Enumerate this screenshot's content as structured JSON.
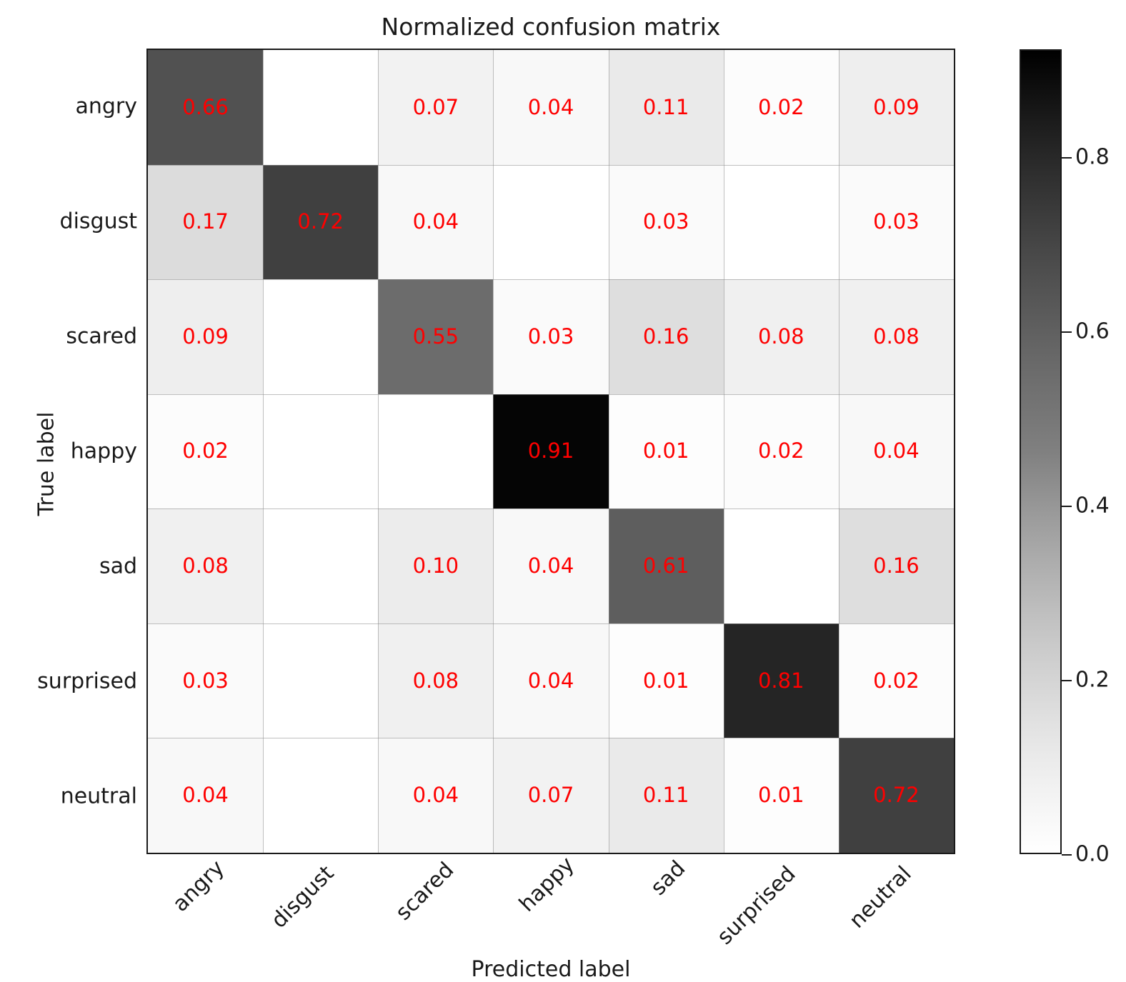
{
  "chart_data": {
    "type": "heatmap",
    "title": "Normalized confusion matrix",
    "xlabel": "Predicted label",
    "ylabel": "True label",
    "categories": [
      "angry",
      "disgust",
      "scared",
      "happy",
      "sad",
      "surprised",
      "neutral"
    ],
    "x_tick_labels": [
      "angry",
      "disgust",
      "scared",
      "happy",
      "sad",
      "surprised",
      "neutral"
    ],
    "y_tick_labels": [
      "angry",
      "disgust",
      "scared",
      "happy",
      "sad",
      "surprised",
      "neutral"
    ],
    "x_tick_rotation": 45,
    "grid": true,
    "legend_position": "right-colorbar",
    "colormap": "Greys",
    "colorbar": {
      "vmin": 0.0,
      "vmax": 0.924,
      "tick_values": [
        0.0,
        0.2,
        0.4,
        0.6,
        0.8
      ],
      "tick_labels": [
        "0.0",
        "0.2",
        "0.4",
        "0.6",
        "0.8"
      ],
      "orientation": "vertical",
      "low_color": "#ffffff",
      "high_color": "#000000"
    },
    "value_text_color": "#fe0000",
    "rows": [
      {
        "label": "angry",
        "values": [
          0.66,
          0.0,
          0.07,
          0.04,
          0.11,
          0.02,
          0.09
        ],
        "display": [
          "0.66",
          "",
          "0.07",
          "0.04",
          "0.11",
          "0.02",
          "0.09"
        ]
      },
      {
        "label": "disgust",
        "values": [
          0.17,
          0.72,
          0.04,
          0.0,
          0.03,
          0.0,
          0.03
        ],
        "display": [
          "0.17",
          "0.72",
          "0.04",
          "",
          "0.03",
          "",
          "0.03"
        ]
      },
      {
        "label": "scared",
        "values": [
          0.09,
          0.0,
          0.55,
          0.03,
          0.16,
          0.08,
          0.08
        ],
        "display": [
          "0.09",
          "",
          "0.55",
          "0.03",
          "0.16",
          "0.08",
          "0.08"
        ]
      },
      {
        "label": "happy",
        "values": [
          0.02,
          0.0,
          0.0,
          0.91,
          0.01,
          0.02,
          0.04
        ],
        "display": [
          "0.02",
          "",
          "",
          "0.91",
          "0.01",
          "0.02",
          "0.04"
        ]
      },
      {
        "label": "sad",
        "values": [
          0.08,
          0.0,
          0.1,
          0.04,
          0.61,
          0.0,
          0.16
        ],
        "display": [
          "0.08",
          "",
          "0.10",
          "0.04",
          "0.61",
          "",
          "0.16"
        ]
      },
      {
        "label": "surprised",
        "values": [
          0.03,
          0.0,
          0.08,
          0.04,
          0.01,
          0.81,
          0.02
        ],
        "display": [
          "0.03",
          "",
          "0.08",
          "0.04",
          "0.01",
          "0.81",
          "0.02"
        ]
      },
      {
        "label": "neutral",
        "values": [
          0.04,
          0.0,
          0.04,
          0.07,
          0.11,
          0.01,
          0.72
        ],
        "display": [
          "0.04",
          "",
          "0.04",
          "0.07",
          "0.11",
          "0.01",
          "0.72"
        ]
      }
    ]
  }
}
